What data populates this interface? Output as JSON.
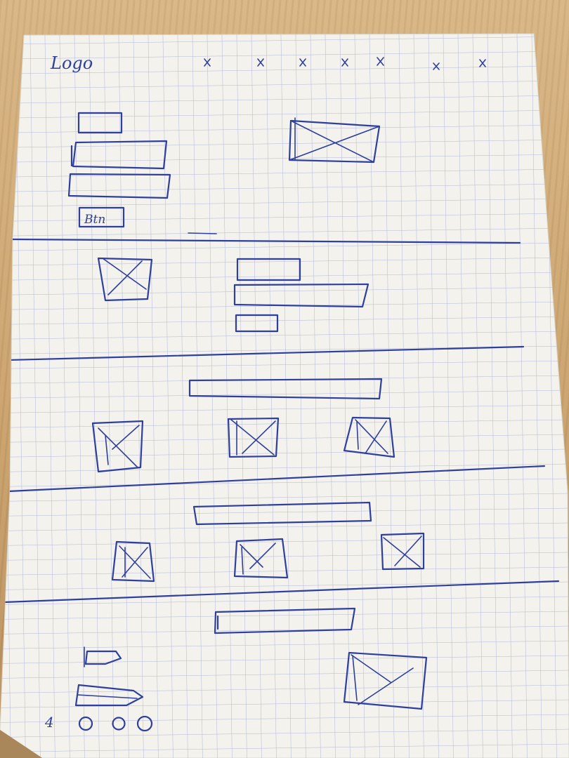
{
  "sketch": {
    "logo_text": "Logo",
    "button_text": "Btn",
    "pagination_number": "4",
    "ink_color": "#2f3f9e",
    "paper_color": "#f3f2ec",
    "grid_color": "#9aa3d6"
  }
}
